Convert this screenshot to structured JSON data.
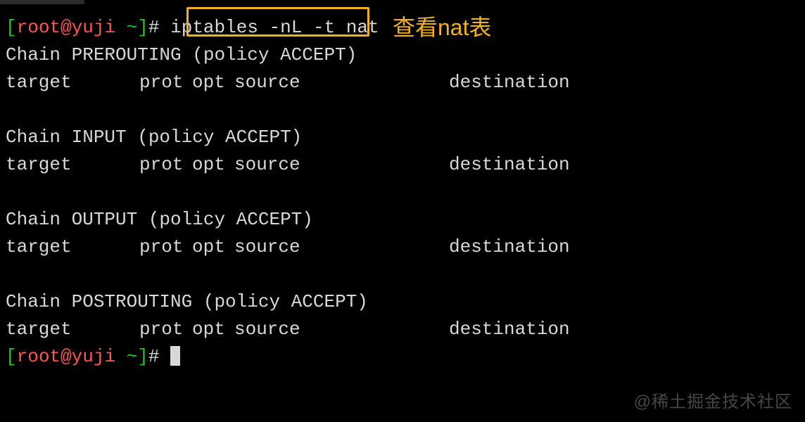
{
  "prompt": {
    "open": "[",
    "user": "root",
    "at": "@",
    "host": "yuji",
    "path": " ~",
    "close": "]",
    "hash": "# "
  },
  "command": "iptables -nL -t nat",
  "annotation": "查看nat表",
  "watermark": "@稀土掘金技术社区",
  "headers": {
    "target": "target",
    "prot": "prot",
    "opt": "opt",
    "source": "source",
    "destination": "destination"
  },
  "chains": [
    {
      "name": "PREROUTING",
      "policy": "ACCEPT"
    },
    {
      "name": "INPUT",
      "policy": "ACCEPT"
    },
    {
      "name": "OUTPUT",
      "policy": "ACCEPT"
    },
    {
      "name": "POSTROUTING",
      "policy": "ACCEPT"
    }
  ],
  "chain_label": "Chain",
  "policy_label": "policy"
}
